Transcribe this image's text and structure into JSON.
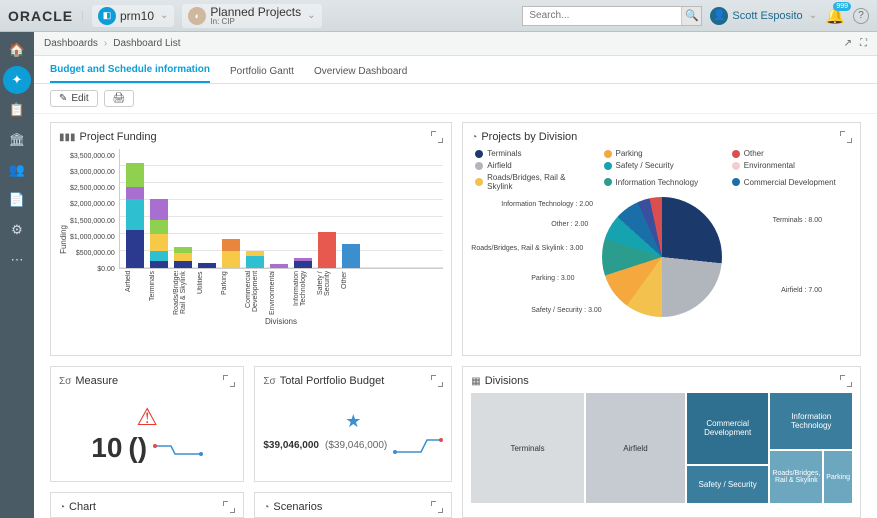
{
  "header": {
    "brand": "ORACLE",
    "context1": "prm10",
    "context2_title": "Planned Projects",
    "context2_sub": "In: CIP",
    "search_placeholder": "Search...",
    "user_name": "Scott Esposito",
    "notif_count": "999"
  },
  "breadcrumb": {
    "root": "Dashboards",
    "current": "Dashboard List"
  },
  "tabs": [
    "Budget and Schedule information",
    "Portfolio Gantt",
    "Overview Dashboard"
  ],
  "toolbar": {
    "edit": "Edit"
  },
  "cards": {
    "funding": {
      "title": "Project Funding",
      "xlabel": "Divisions",
      "ylabel": "Funding"
    },
    "pie": {
      "title": "Projects by Division"
    },
    "measure": {
      "title": "Measure",
      "value": "10",
      "paren": "()"
    },
    "budget": {
      "title": "Total Portfolio Budget",
      "value": "$39,046,000",
      "alt": "($39,046,000)"
    },
    "divisions": {
      "title": "Divisions"
    },
    "chart": {
      "title": "Chart"
    },
    "scenarios": {
      "title": "Scenarios"
    }
  },
  "chart_data": [
    {
      "type": "bar",
      "title": "Project Funding",
      "xlabel": "Divisions",
      "ylabel": "Funding",
      "ylim": [
        0,
        3500000
      ],
      "y_ticks": [
        "$3,500,000.00",
        "$3,000,000.00",
        "$2,500,000.00",
        "$2,000,000.00",
        "$1,500,000.00",
        "$1,000,000.00",
        "$500,000.00",
        "$0.00"
      ],
      "categories": [
        "Airfield",
        "Terminals",
        "Roads/Bridges, Rail & Skylink",
        "Utilities",
        "Parking",
        "Commercial Development",
        "Environmental",
        "Information Technology",
        "Safety / Security",
        "Other"
      ],
      "stacks": [
        [
          {
            "v": 1100000,
            "c": "#2b3a8f"
          },
          {
            "v": 900000,
            "c": "#2ec0d1"
          },
          {
            "v": 350000,
            "c": "#a96fd0"
          },
          {
            "v": 700000,
            "c": "#8fd14f"
          }
        ],
        [
          {
            "v": 200000,
            "c": "#2b3a8f"
          },
          {
            "v": 300000,
            "c": "#2ec0d1"
          },
          {
            "v": 500000,
            "c": "#f7c948"
          },
          {
            "v": 400000,
            "c": "#8fd14f"
          },
          {
            "v": 600000,
            "c": "#a96fd0"
          }
        ],
        [
          {
            "v": 200000,
            "c": "#2b3a8f"
          },
          {
            "v": 250000,
            "c": "#f7c948"
          },
          {
            "v": 150000,
            "c": "#8fd14f"
          }
        ],
        [
          {
            "v": 150000,
            "c": "#2b3a8f"
          }
        ],
        [
          {
            "v": 500000,
            "c": "#f7c948"
          },
          {
            "v": 350000,
            "c": "#e7863c"
          }
        ],
        [
          {
            "v": 350000,
            "c": "#2ec0d1"
          },
          {
            "v": 150000,
            "c": "#f7c948"
          }
        ],
        [
          {
            "v": 120000,
            "c": "#a96fd0"
          }
        ],
        [
          {
            "v": 200000,
            "c": "#2b3a8f"
          },
          {
            "v": 80000,
            "c": "#a96fd0"
          }
        ],
        [
          {
            "v": 1050000,
            "c": "#e7594f"
          }
        ],
        [
          {
            "v": 700000,
            "c": "#3b8fce"
          }
        ]
      ]
    },
    {
      "type": "pie",
      "title": "Projects by Division",
      "series": [
        {
          "name": "Terminals",
          "value": 8.0,
          "color": "#1b3a6b"
        },
        {
          "name": "Airfield",
          "value": 7.0,
          "color": "#b0b6bc"
        },
        {
          "name": "Safety / Security",
          "value": 3.0,
          "color": "#f2c14e"
        },
        {
          "name": "Parking",
          "value": 3.0,
          "color": "#f4a83e"
        },
        {
          "name": "Roads/Bridges, Rail & Skylink",
          "value": 3.0,
          "color": "#2a9d8f"
        },
        {
          "name": "Other",
          "value": 2.0,
          "color": "#16a3b0"
        },
        {
          "name": "Information Technology",
          "value": 2.0,
          "color": "#1b6fa8"
        },
        {
          "name": "Environmental",
          "value": 1.0,
          "color": "#3a4f9e"
        },
        {
          "name": "Commercial Development",
          "value": 1.0,
          "color": "#d94f4f"
        }
      ],
      "legend": [
        {
          "name": "Terminals",
          "color": "#1b3a6b"
        },
        {
          "name": "Parking",
          "color": "#f4a83e"
        },
        {
          "name": "Other",
          "color": "#d94f4f"
        },
        {
          "name": "Airfield",
          "color": "#b0b6bc"
        },
        {
          "name": "Safety / Security",
          "color": "#16a3b0"
        },
        {
          "name": "Environmental",
          "color": "#f4cdd0"
        },
        {
          "name": "Roads/Bridges, Rail & Skylink",
          "color": "#f2c14e"
        },
        {
          "name": "Information Technology",
          "color": "#2a9d8f"
        },
        {
          "name": "Commercial Development",
          "color": "#1b6fa8"
        }
      ],
      "callouts": [
        "Information Technology : 2.00",
        "Other : 2.00",
        "Roads/Bridges, Rail & Skylink : 3.00",
        "Parking : 3.00",
        "Safety / Security : 3.00",
        "Airfield : 7.00",
        "Terminals : 8.00"
      ]
    },
    {
      "type": "treemap",
      "title": "Divisions",
      "items": [
        {
          "name": "Terminals",
          "value": 8,
          "color": "#d9dcdf"
        },
        {
          "name": "Airfield",
          "value": 7,
          "color": "#c5cbd0"
        },
        {
          "name": "Commercial Development",
          "value": 4,
          "color": "#2f6f8f"
        },
        {
          "name": "Safety / Security",
          "value": 3,
          "color": "#3b7d9c"
        },
        {
          "name": "Information Technology",
          "value": 3,
          "color": "#3b7d9c"
        },
        {
          "name": "Roads/Bridges, Rail & Skylink",
          "value": 2,
          "color": "#6da6bf"
        },
        {
          "name": "Parking",
          "value": 1.5,
          "color": "#6da6bf"
        }
      ]
    }
  ]
}
